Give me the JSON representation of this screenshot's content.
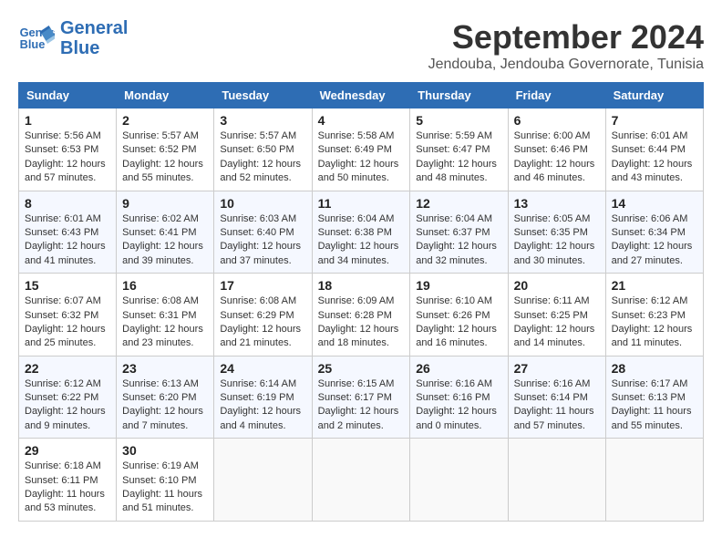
{
  "header": {
    "logo_line1": "General",
    "logo_line2": "Blue",
    "month": "September 2024",
    "location": "Jendouba, Jendouba Governorate, Tunisia"
  },
  "weekdays": [
    "Sunday",
    "Monday",
    "Tuesday",
    "Wednesday",
    "Thursday",
    "Friday",
    "Saturday"
  ],
  "weeks": [
    [
      {
        "day": "1",
        "info": "Sunrise: 5:56 AM\nSunset: 6:53 PM\nDaylight: 12 hours\nand 57 minutes."
      },
      {
        "day": "2",
        "info": "Sunrise: 5:57 AM\nSunset: 6:52 PM\nDaylight: 12 hours\nand 55 minutes."
      },
      {
        "day": "3",
        "info": "Sunrise: 5:57 AM\nSunset: 6:50 PM\nDaylight: 12 hours\nand 52 minutes."
      },
      {
        "day": "4",
        "info": "Sunrise: 5:58 AM\nSunset: 6:49 PM\nDaylight: 12 hours\nand 50 minutes."
      },
      {
        "day": "5",
        "info": "Sunrise: 5:59 AM\nSunset: 6:47 PM\nDaylight: 12 hours\nand 48 minutes."
      },
      {
        "day": "6",
        "info": "Sunrise: 6:00 AM\nSunset: 6:46 PM\nDaylight: 12 hours\nand 46 minutes."
      },
      {
        "day": "7",
        "info": "Sunrise: 6:01 AM\nSunset: 6:44 PM\nDaylight: 12 hours\nand 43 minutes."
      }
    ],
    [
      {
        "day": "8",
        "info": "Sunrise: 6:01 AM\nSunset: 6:43 PM\nDaylight: 12 hours\nand 41 minutes."
      },
      {
        "day": "9",
        "info": "Sunrise: 6:02 AM\nSunset: 6:41 PM\nDaylight: 12 hours\nand 39 minutes."
      },
      {
        "day": "10",
        "info": "Sunrise: 6:03 AM\nSunset: 6:40 PM\nDaylight: 12 hours\nand 37 minutes."
      },
      {
        "day": "11",
        "info": "Sunrise: 6:04 AM\nSunset: 6:38 PM\nDaylight: 12 hours\nand 34 minutes."
      },
      {
        "day": "12",
        "info": "Sunrise: 6:04 AM\nSunset: 6:37 PM\nDaylight: 12 hours\nand 32 minutes."
      },
      {
        "day": "13",
        "info": "Sunrise: 6:05 AM\nSunset: 6:35 PM\nDaylight: 12 hours\nand 30 minutes."
      },
      {
        "day": "14",
        "info": "Sunrise: 6:06 AM\nSunset: 6:34 PM\nDaylight: 12 hours\nand 27 minutes."
      }
    ],
    [
      {
        "day": "15",
        "info": "Sunrise: 6:07 AM\nSunset: 6:32 PM\nDaylight: 12 hours\nand 25 minutes."
      },
      {
        "day": "16",
        "info": "Sunrise: 6:08 AM\nSunset: 6:31 PM\nDaylight: 12 hours\nand 23 minutes."
      },
      {
        "day": "17",
        "info": "Sunrise: 6:08 AM\nSunset: 6:29 PM\nDaylight: 12 hours\nand 21 minutes."
      },
      {
        "day": "18",
        "info": "Sunrise: 6:09 AM\nSunset: 6:28 PM\nDaylight: 12 hours\nand 18 minutes."
      },
      {
        "day": "19",
        "info": "Sunrise: 6:10 AM\nSunset: 6:26 PM\nDaylight: 12 hours\nand 16 minutes."
      },
      {
        "day": "20",
        "info": "Sunrise: 6:11 AM\nSunset: 6:25 PM\nDaylight: 12 hours\nand 14 minutes."
      },
      {
        "day": "21",
        "info": "Sunrise: 6:12 AM\nSunset: 6:23 PM\nDaylight: 12 hours\nand 11 minutes."
      }
    ],
    [
      {
        "day": "22",
        "info": "Sunrise: 6:12 AM\nSunset: 6:22 PM\nDaylight: 12 hours\nand 9 minutes."
      },
      {
        "day": "23",
        "info": "Sunrise: 6:13 AM\nSunset: 6:20 PM\nDaylight: 12 hours\nand 7 minutes."
      },
      {
        "day": "24",
        "info": "Sunrise: 6:14 AM\nSunset: 6:19 PM\nDaylight: 12 hours\nand 4 minutes."
      },
      {
        "day": "25",
        "info": "Sunrise: 6:15 AM\nSunset: 6:17 PM\nDaylight: 12 hours\nand 2 minutes."
      },
      {
        "day": "26",
        "info": "Sunrise: 6:16 AM\nSunset: 6:16 PM\nDaylight: 12 hours\nand 0 minutes."
      },
      {
        "day": "27",
        "info": "Sunrise: 6:16 AM\nSunset: 6:14 PM\nDaylight: 11 hours\nand 57 minutes."
      },
      {
        "day": "28",
        "info": "Sunrise: 6:17 AM\nSunset: 6:13 PM\nDaylight: 11 hours\nand 55 minutes."
      }
    ],
    [
      {
        "day": "29",
        "info": "Sunrise: 6:18 AM\nSunset: 6:11 PM\nDaylight: 11 hours\nand 53 minutes."
      },
      {
        "day": "30",
        "info": "Sunrise: 6:19 AM\nSunset: 6:10 PM\nDaylight: 11 hours\nand 51 minutes."
      },
      {
        "day": "",
        "info": ""
      },
      {
        "day": "",
        "info": ""
      },
      {
        "day": "",
        "info": ""
      },
      {
        "day": "",
        "info": ""
      },
      {
        "day": "",
        "info": ""
      }
    ]
  ]
}
